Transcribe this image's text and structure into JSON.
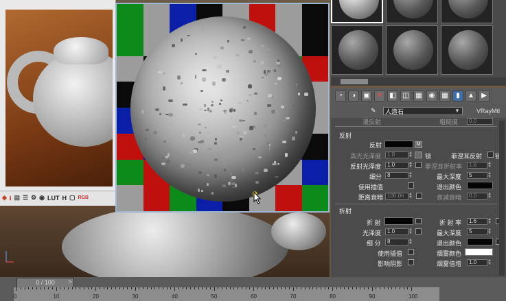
{
  "render_toolbar": {
    "icons": [
      "teapot-render-icon",
      "info-icon",
      "histogram-icon",
      "layers-icon",
      "settings-icon",
      "lock-icon",
      "solo-icon"
    ],
    "labels": {
      "lut": "LUT",
      "h": "H",
      "rgb": "RGB"
    }
  },
  "timeline": {
    "frame_display": "0 / 100",
    "next_arrow": ">",
    "ticks": [
      "0",
      "10",
      "20",
      "30",
      "40",
      "50",
      "60",
      "70",
      "80",
      "90",
      "100"
    ]
  },
  "material_editor": {
    "name": "人造石",
    "type": "VRayMtl",
    "reflection_section": "反射",
    "refraction_section": "折射",
    "reflection": {
      "reflect_label": "反射",
      "m_button": "M",
      "hilight_gloss_label": "高光光泽度",
      "hilight_gloss_value": "1.0",
      "lock_label": "锁",
      "fresnel_label": "菲涅耳反射",
      "lock2_label": "锁",
      "refl_gloss_label": "反射光泽度",
      "refl_gloss_value": "1.0",
      "fresnel_ior_label": "菲涅耳折射率",
      "fresnel_ior_value": "1.6",
      "subdivs_label": "细分",
      "subdivs_value": "8",
      "max_depth_label": "最大深度",
      "max_depth_value": "5",
      "use_interp_label": "使用插值",
      "exit_color_label": "退出颜色",
      "dim_distance_label": "距离衰暗",
      "dim_distance_value": "100.0n",
      "dim_falloff_label": "衰减衰暗",
      "dim_falloff_value": "0.0"
    },
    "refraction": {
      "refract_label": "折 射",
      "ior_label": "折 射 率",
      "ior_value": "1.6",
      "gloss_label": "光泽度",
      "gloss_value": "1.0",
      "max_depth_label": "最大深度",
      "max_depth_value": "5",
      "subdivs_label": "细 分",
      "subdivs_value": "8",
      "exit_color_label": "退出颜色",
      "use_interp_label": "使用插值",
      "fog_color_label": "烟雾颜色",
      "affect_shadows_label": "影响阴影",
      "fog_mult_label": "烟雾倍增",
      "fog_mult_value": "1.0"
    },
    "partial_top": {
      "left_label": "漫反射",
      "right_label": "粗糙度",
      "right_value": "0.0"
    }
  },
  "colors": {
    "checker_red": "#c0100e",
    "checker_green": "#0c8a1a",
    "checker_blue": "#0b1ea8",
    "checker_black": "#0a0a0a",
    "checker_gray": "#9c9c9c",
    "active_tool": "#3c6ea8",
    "preview_border": "#9fb6d0"
  }
}
